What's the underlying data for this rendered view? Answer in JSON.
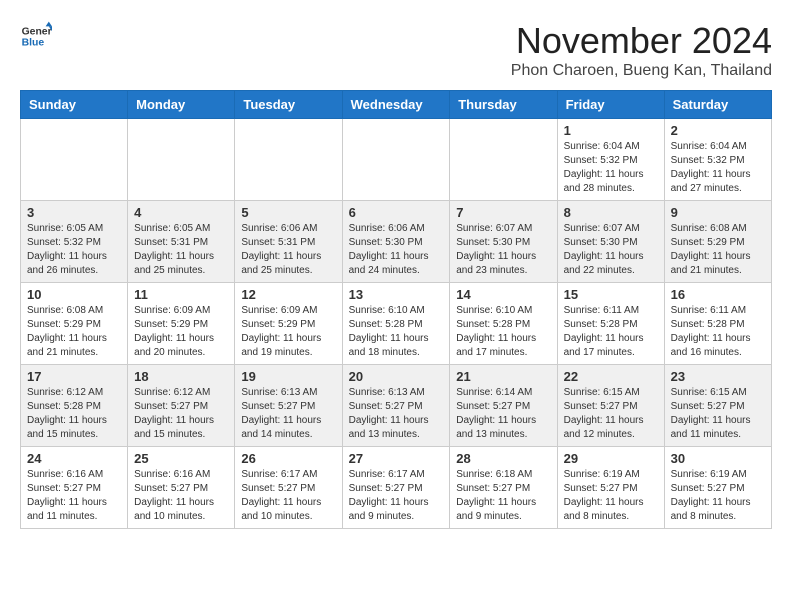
{
  "header": {
    "logo_general": "General",
    "logo_blue": "Blue",
    "month_title": "November 2024",
    "location": "Phon Charoen, Bueng Kan, Thailand"
  },
  "weekdays": [
    "Sunday",
    "Monday",
    "Tuesday",
    "Wednesday",
    "Thursday",
    "Friday",
    "Saturday"
  ],
  "weeks": [
    [
      {
        "day": "",
        "info": ""
      },
      {
        "day": "",
        "info": ""
      },
      {
        "day": "",
        "info": ""
      },
      {
        "day": "",
        "info": ""
      },
      {
        "day": "",
        "info": ""
      },
      {
        "day": "1",
        "info": "Sunrise: 6:04 AM\nSunset: 5:32 PM\nDaylight: 11 hours\nand 28 minutes."
      },
      {
        "day": "2",
        "info": "Sunrise: 6:04 AM\nSunset: 5:32 PM\nDaylight: 11 hours\nand 27 minutes."
      }
    ],
    [
      {
        "day": "3",
        "info": "Sunrise: 6:05 AM\nSunset: 5:32 PM\nDaylight: 11 hours\nand 26 minutes."
      },
      {
        "day": "4",
        "info": "Sunrise: 6:05 AM\nSunset: 5:31 PM\nDaylight: 11 hours\nand 25 minutes."
      },
      {
        "day": "5",
        "info": "Sunrise: 6:06 AM\nSunset: 5:31 PM\nDaylight: 11 hours\nand 25 minutes."
      },
      {
        "day": "6",
        "info": "Sunrise: 6:06 AM\nSunset: 5:30 PM\nDaylight: 11 hours\nand 24 minutes."
      },
      {
        "day": "7",
        "info": "Sunrise: 6:07 AM\nSunset: 5:30 PM\nDaylight: 11 hours\nand 23 minutes."
      },
      {
        "day": "8",
        "info": "Sunrise: 6:07 AM\nSunset: 5:30 PM\nDaylight: 11 hours\nand 22 minutes."
      },
      {
        "day": "9",
        "info": "Sunrise: 6:08 AM\nSunset: 5:29 PM\nDaylight: 11 hours\nand 21 minutes."
      }
    ],
    [
      {
        "day": "10",
        "info": "Sunrise: 6:08 AM\nSunset: 5:29 PM\nDaylight: 11 hours\nand 21 minutes."
      },
      {
        "day": "11",
        "info": "Sunrise: 6:09 AM\nSunset: 5:29 PM\nDaylight: 11 hours\nand 20 minutes."
      },
      {
        "day": "12",
        "info": "Sunrise: 6:09 AM\nSunset: 5:29 PM\nDaylight: 11 hours\nand 19 minutes."
      },
      {
        "day": "13",
        "info": "Sunrise: 6:10 AM\nSunset: 5:28 PM\nDaylight: 11 hours\nand 18 minutes."
      },
      {
        "day": "14",
        "info": "Sunrise: 6:10 AM\nSunset: 5:28 PM\nDaylight: 11 hours\nand 17 minutes."
      },
      {
        "day": "15",
        "info": "Sunrise: 6:11 AM\nSunset: 5:28 PM\nDaylight: 11 hours\nand 17 minutes."
      },
      {
        "day": "16",
        "info": "Sunrise: 6:11 AM\nSunset: 5:28 PM\nDaylight: 11 hours\nand 16 minutes."
      }
    ],
    [
      {
        "day": "17",
        "info": "Sunrise: 6:12 AM\nSunset: 5:28 PM\nDaylight: 11 hours\nand 15 minutes."
      },
      {
        "day": "18",
        "info": "Sunrise: 6:12 AM\nSunset: 5:27 PM\nDaylight: 11 hours\nand 15 minutes."
      },
      {
        "day": "19",
        "info": "Sunrise: 6:13 AM\nSunset: 5:27 PM\nDaylight: 11 hours\nand 14 minutes."
      },
      {
        "day": "20",
        "info": "Sunrise: 6:13 AM\nSunset: 5:27 PM\nDaylight: 11 hours\nand 13 minutes."
      },
      {
        "day": "21",
        "info": "Sunrise: 6:14 AM\nSunset: 5:27 PM\nDaylight: 11 hours\nand 13 minutes."
      },
      {
        "day": "22",
        "info": "Sunrise: 6:15 AM\nSunset: 5:27 PM\nDaylight: 11 hours\nand 12 minutes."
      },
      {
        "day": "23",
        "info": "Sunrise: 6:15 AM\nSunset: 5:27 PM\nDaylight: 11 hours\nand 11 minutes."
      }
    ],
    [
      {
        "day": "24",
        "info": "Sunrise: 6:16 AM\nSunset: 5:27 PM\nDaylight: 11 hours\nand 11 minutes."
      },
      {
        "day": "25",
        "info": "Sunrise: 6:16 AM\nSunset: 5:27 PM\nDaylight: 11 hours\nand 10 minutes."
      },
      {
        "day": "26",
        "info": "Sunrise: 6:17 AM\nSunset: 5:27 PM\nDaylight: 11 hours\nand 10 minutes."
      },
      {
        "day": "27",
        "info": "Sunrise: 6:17 AM\nSunset: 5:27 PM\nDaylight: 11 hours\nand 9 minutes."
      },
      {
        "day": "28",
        "info": "Sunrise: 6:18 AM\nSunset: 5:27 PM\nDaylight: 11 hours\nand 9 minutes."
      },
      {
        "day": "29",
        "info": "Sunrise: 6:19 AM\nSunset: 5:27 PM\nDaylight: 11 hours\nand 8 minutes."
      },
      {
        "day": "30",
        "info": "Sunrise: 6:19 AM\nSunset: 5:27 PM\nDaylight: 11 hours\nand 8 minutes."
      }
    ]
  ]
}
